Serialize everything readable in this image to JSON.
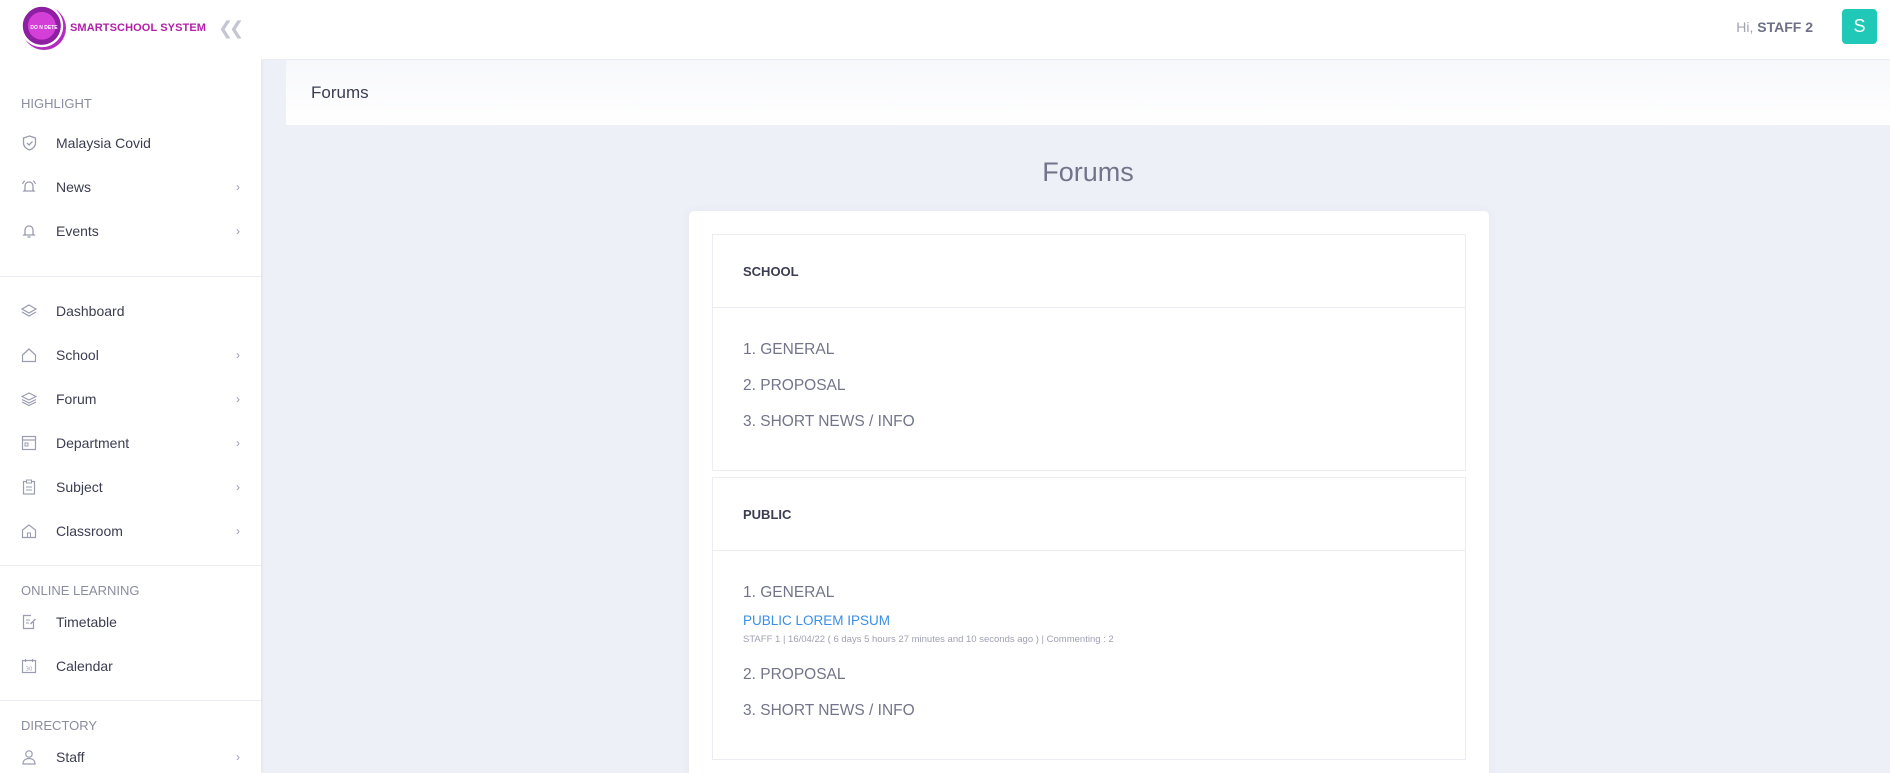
{
  "brand": {
    "logo_text": "DO N DETE",
    "name": "SMARTSCHOOL SYSTEM"
  },
  "header": {
    "greeting": "Hi,",
    "user": "STAFF 2",
    "avatar_letter": "S"
  },
  "subheader": {
    "title": "Forums"
  },
  "sidebar": {
    "sections": [
      {
        "title": "HIGHLIGHT",
        "items": [
          {
            "label": "Malaysia Covid",
            "icon": "shield-icon",
            "chevron": false
          },
          {
            "label": "News",
            "icon": "bell-ring-icon",
            "chevron": true
          },
          {
            "label": "Events",
            "icon": "bell-icon",
            "chevron": true
          }
        ]
      },
      {
        "title": "",
        "items": [
          {
            "label": "Dashboard",
            "icon": "layers-icon",
            "chevron": false
          },
          {
            "label": "School",
            "icon": "home-icon",
            "chevron": true
          },
          {
            "label": "Forum",
            "icon": "stack-icon",
            "chevron": true
          },
          {
            "label": "Department",
            "icon": "calendar-grid-icon",
            "chevron": true
          },
          {
            "label": "Subject",
            "icon": "clipboard-icon",
            "chevron": true
          },
          {
            "label": "Classroom",
            "icon": "building-icon",
            "chevron": true
          }
        ]
      },
      {
        "title": "ONLINE LEARNING",
        "items": [
          {
            "label": "Timetable",
            "icon": "edit-note-icon",
            "chevron": false
          },
          {
            "label": "Calendar",
            "icon": "calendar-icon",
            "chevron": false
          }
        ]
      },
      {
        "title": "DIRECTORY",
        "items": [
          {
            "label": "Staff",
            "icon": "user-icon",
            "chevron": true
          }
        ]
      }
    ]
  },
  "main": {
    "heading": "Forums",
    "categories": [
      {
        "name": "SCHOOL",
        "topics": [
          {
            "label": "1. GENERAL",
            "posts": []
          },
          {
            "label": "2. PROPOSAL",
            "posts": []
          },
          {
            "label": "3. SHORT NEWS / INFO",
            "posts": []
          }
        ]
      },
      {
        "name": "PUBLIC",
        "topics": [
          {
            "label": "1. GENERAL",
            "posts": [
              {
                "title": "PUBLIC LOREM IPSUM",
                "meta": "STAFF 1 | 16/04/22 ( 6 days 5 hours 27 minutes and 10 seconds ago ) | Commenting : 2"
              }
            ]
          },
          {
            "label": "2. PROPOSAL",
            "posts": []
          },
          {
            "label": "3. SHORT NEWS / INFO",
            "posts": []
          }
        ]
      }
    ]
  }
}
